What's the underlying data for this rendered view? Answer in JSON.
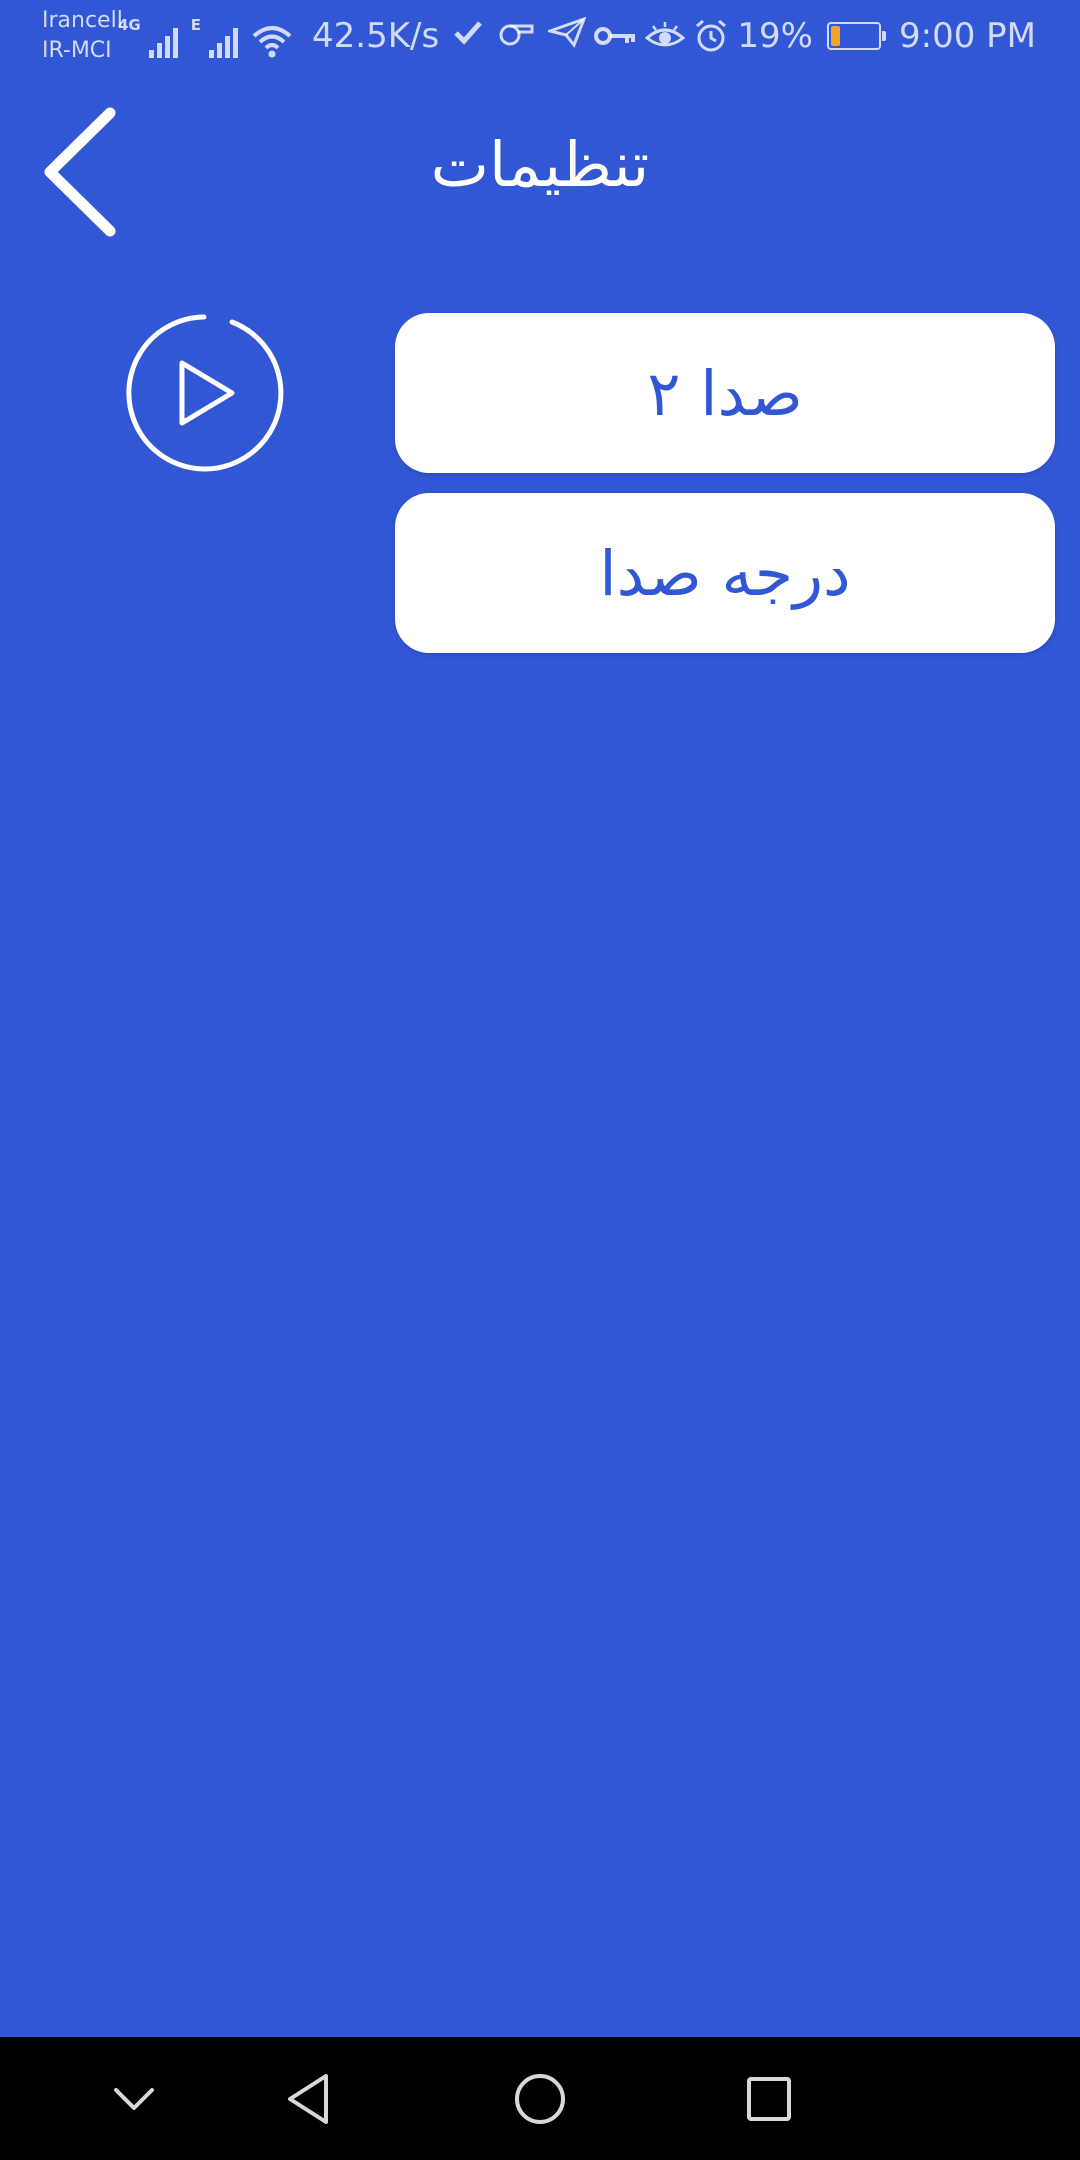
{
  "status_bar": {
    "carrier_primary": "Irancell",
    "carrier_secondary": "IR-MCI",
    "network_type": "4G",
    "network_type_2": "E",
    "speed": "42.5K/s",
    "battery_percent": "19%",
    "battery_level": 0.19,
    "battery_color": "#F2A428",
    "time": "9:00 PM",
    "icons": [
      "signal-icon",
      "wifi-icon",
      "check-icon",
      "whistle-icon",
      "telegram-icon",
      "key-icon",
      "eye-icon",
      "alarm-icon",
      "battery-icon"
    ]
  },
  "header": {
    "title": "تنظیمات",
    "back_icon": "chevron-left-icon"
  },
  "content": {
    "play_icon": "play-circle-icon",
    "menu_items": [
      {
        "label": "صدا ۲"
      },
      {
        "label": "درجه صدا"
      }
    ]
  },
  "nav_bar": {
    "icons": [
      "chevron-down-icon",
      "back-triangle-icon",
      "home-circle-icon",
      "recents-square-icon"
    ]
  },
  "colors": {
    "background": "#3157D5",
    "card": "#FFFFFF",
    "card_text": "#3157D5",
    "nav_bar": "#000000"
  }
}
